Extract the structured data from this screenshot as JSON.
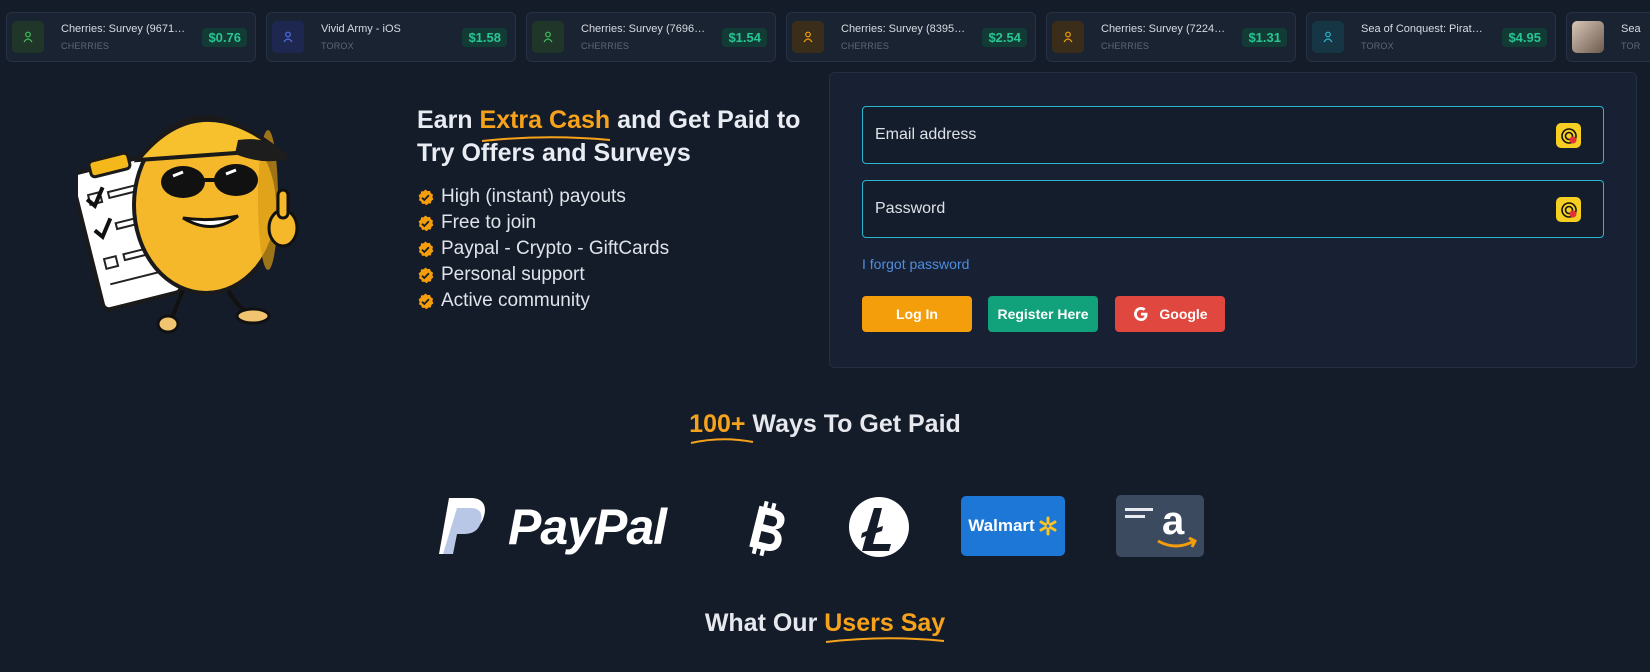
{
  "ticker": [
    {
      "title": "Cherries: Survey (96714...",
      "provider": "CHERRIES",
      "price": "$0.76",
      "icon": "user-icon",
      "color": "#3fbf5a",
      "bg": "#1f3628"
    },
    {
      "title": "Vivid Army - iOS",
      "provider": "TOROX",
      "price": "$1.58",
      "icon": "user-icon",
      "color": "#4c6fe6",
      "bg": "#1e2750"
    },
    {
      "title": "Cherries: Survey (76968...",
      "provider": "CHERRIES",
      "price": "$1.54",
      "icon": "user-icon",
      "color": "#3fbf5a",
      "bg": "#1f3628"
    },
    {
      "title": "Cherries: Survey (83955...",
      "provider": "CHERRIES",
      "price": "$2.54",
      "icon": "user-icon",
      "color": "#f59e0b",
      "bg": "#3a2d1a"
    },
    {
      "title": "Cherries: Survey (72240...",
      "provider": "CHERRIES",
      "price": "$1.31",
      "icon": "user-icon",
      "color": "#f59e0b",
      "bg": "#3a2d1a"
    },
    {
      "title": "Sea of Conquest: Pirate ...",
      "provider": "TOROX",
      "price": "$4.95",
      "icon": "user-icon",
      "color": "#2fb6cf",
      "bg": "#163645"
    },
    {
      "title": "Sea",
      "provider": "TOR",
      "price": "",
      "icon": "photo-avatar",
      "color": "",
      "bg": ""
    }
  ],
  "hero": {
    "title_part1": "Earn ",
    "title_accent": "Extra Cash",
    "title_part2": " and Get Paid to Try Offers and Surveys",
    "features": [
      "High (instant) payouts",
      "Free to join",
      "Paypal - Crypto - GiftCards",
      "Personal support",
      "Active community"
    ]
  },
  "login": {
    "email_placeholder": "Email address",
    "password_placeholder": "Password",
    "forgot": "I forgot password",
    "login_btn": "Log In",
    "register_btn": "Register Here",
    "google_btn": "Google"
  },
  "ways": {
    "accent": "100+",
    "rest": " Ways To Get Paid"
  },
  "payment_methods": {
    "paypal": "PayPal",
    "walmart": "Walmart",
    "amazon": "a"
  },
  "users_section": {
    "prefix": "What Our ",
    "accent": "Users Say"
  },
  "colors": {
    "accent": "#f7a21b",
    "bg": "#141c29",
    "teal": "#12a27b",
    "google": "#e0473e",
    "field_border": "#2fb6cf"
  }
}
